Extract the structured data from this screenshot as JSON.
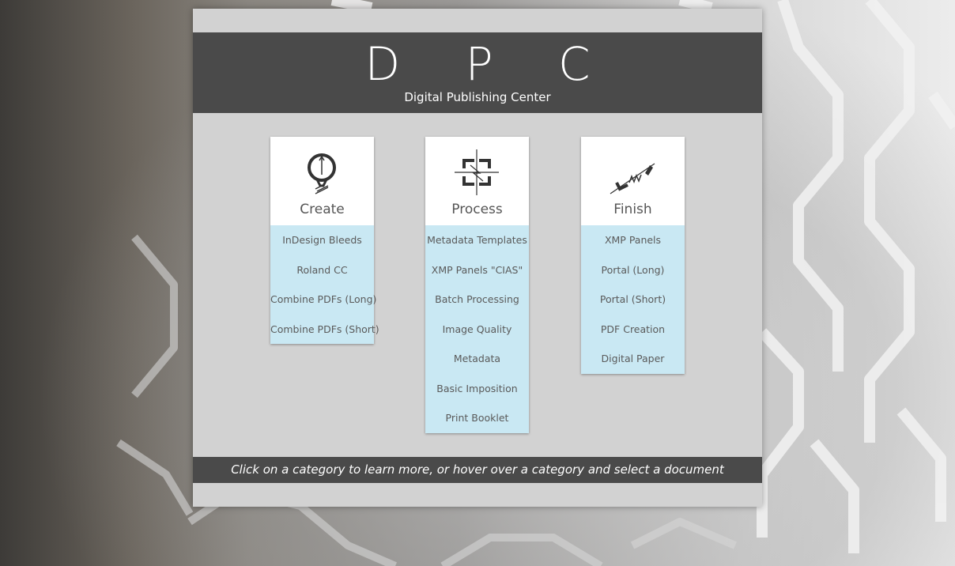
{
  "header": {
    "logo": "D P C",
    "subtitle": "Digital Publishing Center"
  },
  "categories": [
    {
      "title": "Create",
      "icon": "lightbulb-icon",
      "items": [
        "InDesign Bleeds",
        "Roland CC",
        "Combine PDFs (Long)",
        "Combine PDFs (Short)"
      ]
    },
    {
      "title": "Process",
      "icon": "crop-frame-icon",
      "items": [
        "Metadata Templates",
        "XMP Panels \"CIAS\"",
        "Batch Processing",
        "Image Quality",
        "Metadata",
        "Basic Imposition",
        "Print Booklet"
      ]
    },
    {
      "title": "Finish",
      "icon": "probe-icon",
      "items": [
        "XMP Panels",
        "Portal (Long)",
        "Portal (Short)",
        "PDF Creation",
        "Digital Paper"
      ]
    }
  ],
  "footer": {
    "text": "Click on a category to learn more, or hover over a category and select a document"
  },
  "colors": {
    "header_bg": "#4a4a4a",
    "panel_bg": "#d2d2d2",
    "item_bg": "#c9e8f3"
  }
}
